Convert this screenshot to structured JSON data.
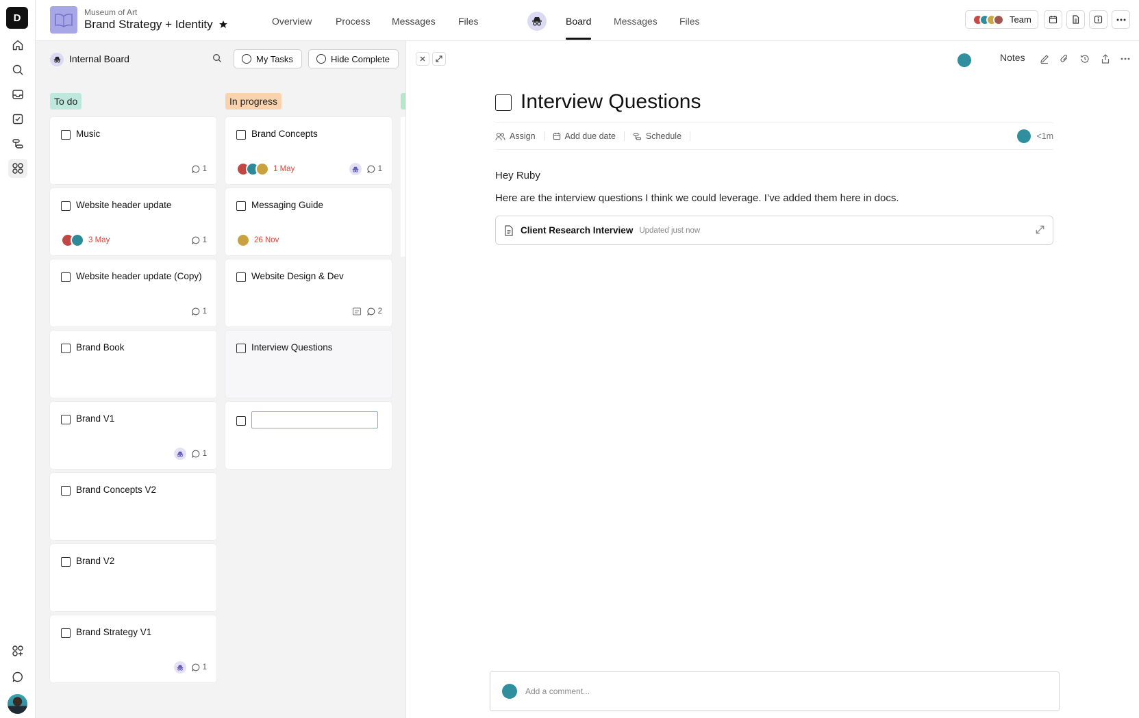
{
  "rail": {
    "logo_letter": "D",
    "icons": [
      "home-icon",
      "search-icon",
      "inbox-icon",
      "tasks-icon",
      "workflow-icon",
      "apps-icon"
    ],
    "bottom_icons": [
      "add-apps-icon",
      "chat-icon"
    ]
  },
  "header": {
    "project_subtitle": "Museum of Art",
    "project_title": "Brand Strategy + Identity",
    "nav_left": [
      "Overview",
      "Process",
      "Messages",
      "Files"
    ],
    "nav_right": [
      "Board",
      "Messages",
      "Files"
    ],
    "active_tab": "Board",
    "team_label": "Team"
  },
  "board": {
    "title": "Internal Board",
    "my_tasks_label": "My Tasks",
    "hide_complete_label": "Hide Complete",
    "columns": [
      {
        "label": "To do",
        "color": "#bfe8dd"
      },
      {
        "label": "In progress",
        "color": "#f8d3ad"
      }
    ],
    "todo": [
      {
        "title": "Music",
        "comments": "1"
      },
      {
        "title": "Website header update",
        "date": "3 May",
        "comments": "1"
      },
      {
        "title": "Website header update (Copy)",
        "comments": "1"
      },
      {
        "title": "Brand Book"
      },
      {
        "title": "Brand V1",
        "comments": "1"
      },
      {
        "title": "Brand Concepts V2"
      },
      {
        "title": "Brand V2"
      },
      {
        "title": "Brand Strategy V1",
        "comments": "1"
      }
    ],
    "in_progress": [
      {
        "title": "Brand Concepts",
        "date": "1 May",
        "comments": "1"
      },
      {
        "title": "Messaging Guide",
        "date": "26 Nov"
      },
      {
        "title": "Website Design & Dev",
        "comments": "2"
      },
      {
        "title": "Interview Questions"
      }
    ]
  },
  "detail": {
    "notes_label": "Notes",
    "title": "Interview Questions",
    "assign_label": "Assign",
    "due_label": "Add due date",
    "schedule_label": "Schedule",
    "time_ago": "<1m",
    "greeting": "Hey Ruby",
    "body": "Here are the interview questions I think we could leverage. I’ve added them here in docs.",
    "doc_name": "Client Research Interview",
    "doc_updated": "Updated just now",
    "comment_placeholder": "Add a comment..."
  }
}
